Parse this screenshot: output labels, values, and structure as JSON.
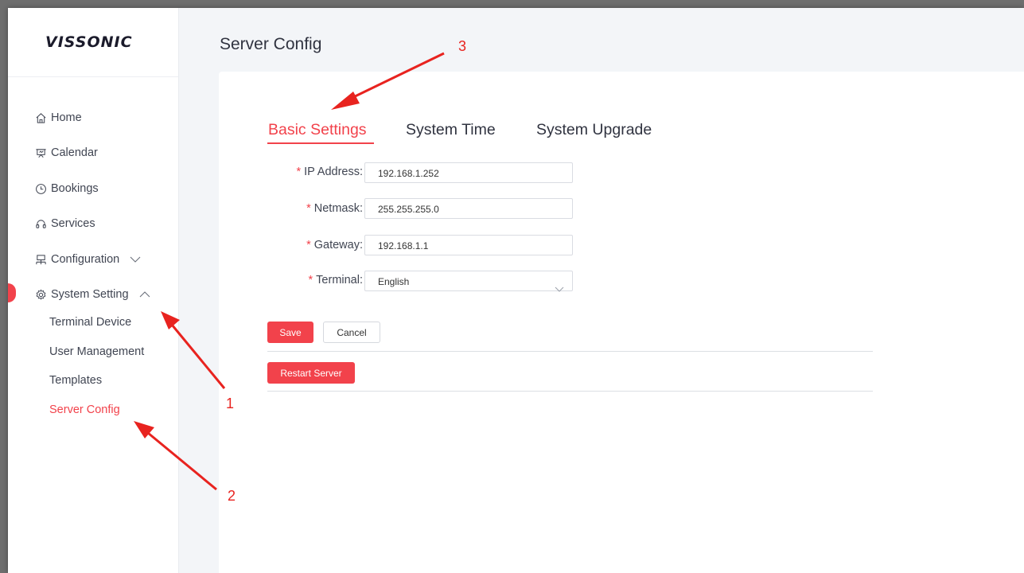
{
  "app": {
    "logo": "VISSONIC"
  },
  "sidebar": {
    "items": [
      {
        "label": "Home",
        "icon": "home-icon"
      },
      {
        "label": "Calendar",
        "icon": "calendar-board-icon"
      },
      {
        "label": "Bookings",
        "icon": "clock-icon"
      },
      {
        "label": "Services",
        "icon": "headset-icon"
      },
      {
        "label": "Configuration",
        "icon": "network-icon",
        "expanded": false
      },
      {
        "label": "System Setting",
        "icon": "gear-icon",
        "expanded": true
      }
    ],
    "sub_items": [
      {
        "label": "Terminal Device"
      },
      {
        "label": "User Management"
      },
      {
        "label": "Templates"
      },
      {
        "label": "Server Config",
        "active": true
      }
    ]
  },
  "page": {
    "title": "Server Config"
  },
  "tabs": [
    {
      "label": "Basic Settings",
      "active": true
    },
    {
      "label": "System Time"
    },
    {
      "label": "System Upgrade"
    }
  ],
  "form": {
    "ip_label": "IP Address:",
    "ip_value": "192.168.1.252",
    "netmask_label": "Netmask:",
    "netmask_value": "255.255.255.0",
    "gateway_label": "Gateway:",
    "gateway_value": "192.168.1.1",
    "terminal_label": "Terminal:",
    "terminal_value": "English",
    "required_mark": "*"
  },
  "buttons": {
    "save": "Save",
    "cancel": "Cancel",
    "restart": "Restart Server"
  },
  "annotations": [
    "1",
    "2",
    "3"
  ],
  "colors": {
    "accent": "#f2424b",
    "annotation": "#e8231f"
  }
}
